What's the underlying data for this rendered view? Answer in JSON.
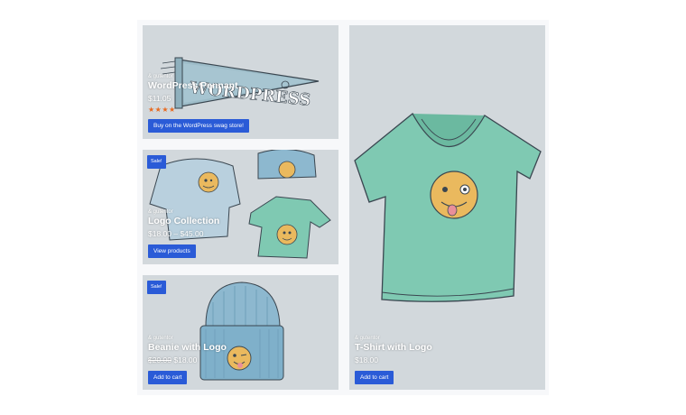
{
  "products": [
    {
      "author": "& gutentor",
      "title": "WordPress Pennant",
      "price": "$11.05",
      "rating_stars": 4,
      "stars_text": "★★★★",
      "button": "Buy on the WordPress swag store!",
      "image": "pennant-image"
    },
    {
      "badge": "Sale!",
      "author": "& gutentor",
      "title": "Logo Collection",
      "price": "$18.00 – $45.00",
      "button": "View products",
      "image": "hoodie-beanie-tshirt-image"
    },
    {
      "badge": "Sale!",
      "author": "& gutentor",
      "title": "Beanie with Logo",
      "price_old": "$20.00",
      "price": "$18.00",
      "button": "Add to cart",
      "image": "beanie-image"
    },
    {
      "author": "& gutentor",
      "title": "T-Shirt with Logo",
      "price": "$18.00",
      "button": "Add to cart",
      "image": "tshirt-image"
    }
  ],
  "colors": {
    "card_bg": "#d2d8dc",
    "button": "#2a5bd7",
    "star": "#e8691f",
    "shirt": "#6fbfa5",
    "beanie": "#78a9c4",
    "hoodie": "#a9c6d8",
    "emoji": "#eab95e"
  }
}
